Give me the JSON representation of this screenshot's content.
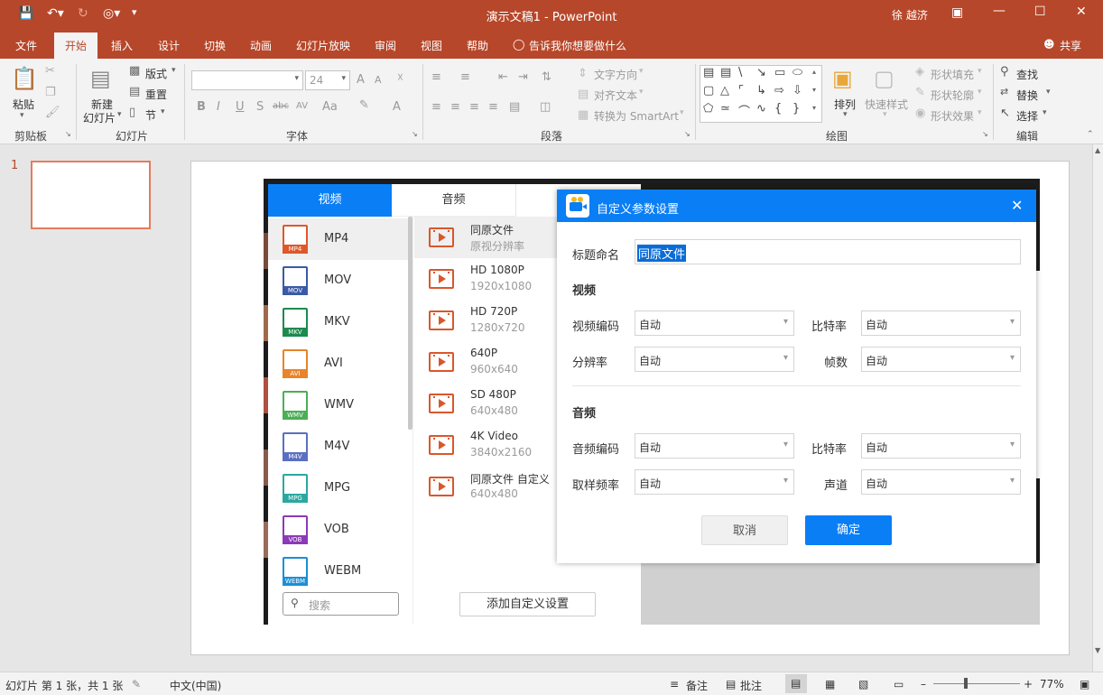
{
  "app": {
    "doc_title": "演示文稿1",
    "app_name": "PowerPoint",
    "separator": "-",
    "user": "徐 越济"
  },
  "tabs": [
    "文件",
    "开始",
    "插入",
    "设计",
    "切换",
    "动画",
    "幻灯片放映",
    "审阅",
    "视图",
    "帮助"
  ],
  "tell_me": "告诉我你想要做什么",
  "share": "共享",
  "ribbon": {
    "clipboard": {
      "paste": "粘贴",
      "group": "剪贴板"
    },
    "slides": {
      "new_slide_1": "新建",
      "new_slide_2": "幻灯片",
      "layout": "版式",
      "reset": "重置",
      "section": "节",
      "group": "幻灯片"
    },
    "font": {
      "font_size": "24",
      "group": "字体",
      "bold": "B",
      "italic": "I",
      "underline": "U",
      "shadow": "S",
      "strike": "abc",
      "spacing": "AV",
      "case": "Aa",
      "grow": "A",
      "shrink": "A",
      "color": "A"
    },
    "paragraph": {
      "direction": "文字方向",
      "align": "对齐文本",
      "smartart": "转换为 SmartArt",
      "group": "段落"
    },
    "drawing": {
      "arrange": "排列",
      "quick_styles": "快速样式",
      "fill": "形状填充",
      "outline": "形状轮廓",
      "effects": "形状效果",
      "group": "绘图"
    },
    "editing": {
      "find": "查找",
      "replace": "替换",
      "select": "选择",
      "group": "编辑"
    }
  },
  "thumb": {
    "number": "1"
  },
  "status": {
    "slide_info": "幻灯片 第 1 张，共 1 张",
    "language": "中文(中国)",
    "notes": "备注",
    "comments": "批注",
    "zoom": "77%",
    "zoom_level": 77
  },
  "converter": {
    "tab_video": "视频",
    "tab_audio": "音频",
    "formats": [
      "MP4",
      "MOV",
      "MKV",
      "AVI",
      "WMV",
      "M4V",
      "MPG",
      "VOB",
      "WEBM"
    ],
    "format_colors": [
      "#e0572a",
      "#3a5aa8",
      "#1d8a4e",
      "#e8842a",
      "#4cae57",
      "#5b6fc2",
      "#2aa8a0",
      "#8b3ab8",
      "#1a8fd6"
    ],
    "search_placeholder": "搜索",
    "presets": [
      {
        "title": "同原文件",
        "sub": "原视分辨率"
      },
      {
        "title": "HD 1080P",
        "sub": "1920x1080"
      },
      {
        "title": "HD 720P",
        "sub": "1280x720"
      },
      {
        "title": "640P",
        "sub": "960x640"
      },
      {
        "title": "SD 480P",
        "sub": "640x480"
      },
      {
        "title": "4K Video",
        "sub": "3840x2160"
      },
      {
        "title": "同原文件 自定义",
        "sub": "640x480"
      }
    ],
    "add_custom": "添加自定义设置"
  },
  "dialog": {
    "title": "自定义参数设置",
    "name_label": "标题命名",
    "name_value": "同原文件",
    "video_header": "视频",
    "video_codec": "视频编码",
    "video_bitrate": "比特率",
    "resolution": "分辨率",
    "fps": "帧数",
    "audio_header": "音频",
    "audio_codec": "音频编码",
    "audio_bitrate": "比特率",
    "sample_rate": "取样频率",
    "channels": "声道",
    "auto": "自动",
    "cancel": "取消",
    "ok": "确定"
  },
  "colors": {
    "accent": "#b7472a",
    "blue": "#0a7ef5"
  }
}
